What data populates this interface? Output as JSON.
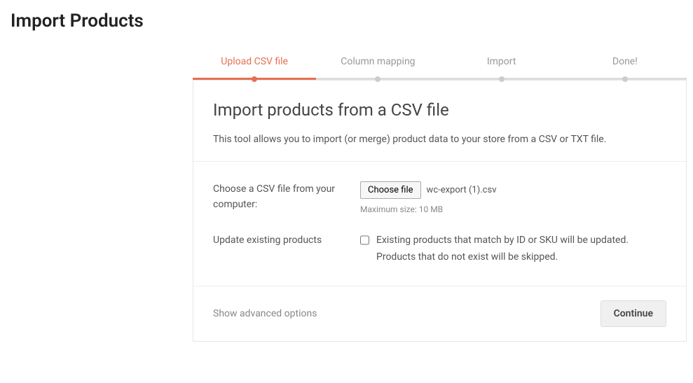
{
  "page": {
    "title": "Import Products"
  },
  "steps": [
    {
      "label": "Upload CSV file",
      "active": true
    },
    {
      "label": "Column mapping",
      "active": false
    },
    {
      "label": "Import",
      "active": false
    },
    {
      "label": "Done!",
      "active": false
    }
  ],
  "card": {
    "title": "Import products from a CSV file",
    "description": "This tool allows you to import (or merge) product data to your store from a CSV or TXT file."
  },
  "form": {
    "fileLabel": "Choose a CSV file from your computer:",
    "chooseFileBtn": "Choose file",
    "fileName": "wc-export (1).csv",
    "maxSize": "Maximum size: 10 MB",
    "updateLabel": "Update existing products",
    "updateHelp": "Existing products that match by ID or SKU will be updated. Products that do not exist will be skipped."
  },
  "footer": {
    "advancedLink": "Show advanced options",
    "continueBtn": "Continue"
  }
}
